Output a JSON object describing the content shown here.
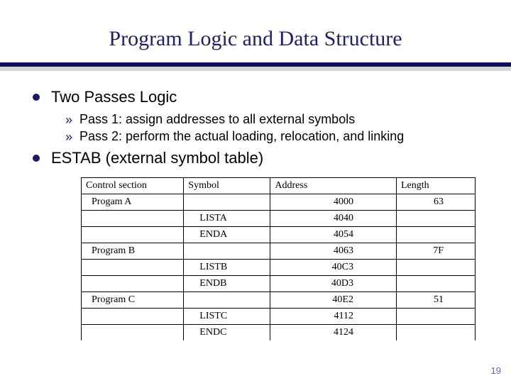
{
  "title": "Program Logic and Data Structure",
  "bullets": [
    {
      "text": "Two Passes Logic",
      "sub": [
        "Pass 1: assign addresses to all external symbols",
        "Pass 2: perform the actual loading, relocation, and linking"
      ]
    },
    {
      "text": "ESTAB (external symbol table)",
      "sub": []
    }
  ],
  "table": {
    "headers": [
      "Control section",
      "Symbol",
      "Address",
      "Length"
    ],
    "rows": [
      {
        "cs": "Progam A",
        "sym": "",
        "addr": "4000",
        "len": "63"
      },
      {
        "cs": "",
        "sym": "LISTA",
        "addr": "4040",
        "len": ""
      },
      {
        "cs": "",
        "sym": "ENDA",
        "addr": "4054",
        "len": ""
      },
      {
        "cs": "Program B",
        "sym": "",
        "addr": "4063",
        "len": "7F"
      },
      {
        "cs": "",
        "sym": "LISTB",
        "addr": "40C3",
        "len": ""
      },
      {
        "cs": "",
        "sym": "ENDB",
        "addr": "40D3",
        "len": ""
      },
      {
        "cs": "Program C",
        "sym": "",
        "addr": "40E2",
        "len": "51"
      },
      {
        "cs": "",
        "sym": "LISTC",
        "addr": "4112",
        "len": ""
      },
      {
        "cs": "",
        "sym": "ENDC",
        "addr": "4124",
        "len": ""
      }
    ]
  },
  "page_number": "19",
  "chart_data": {
    "type": "table",
    "title": "ESTAB (external symbol table)",
    "columns": [
      "Control section",
      "Symbol",
      "Address",
      "Length"
    ],
    "rows": [
      [
        "Progam A",
        "",
        "4000",
        "63"
      ],
      [
        "",
        "LISTA",
        "4040",
        ""
      ],
      [
        "",
        "ENDA",
        "4054",
        ""
      ],
      [
        "Program B",
        "",
        "4063",
        "7F"
      ],
      [
        "",
        "LISTB",
        "40C3",
        ""
      ],
      [
        "",
        "ENDB",
        "40D3",
        ""
      ],
      [
        "Program C",
        "",
        "40E2",
        "51"
      ],
      [
        "",
        "LISTC",
        "4112",
        ""
      ],
      [
        "",
        "ENDC",
        "4124",
        ""
      ]
    ]
  }
}
